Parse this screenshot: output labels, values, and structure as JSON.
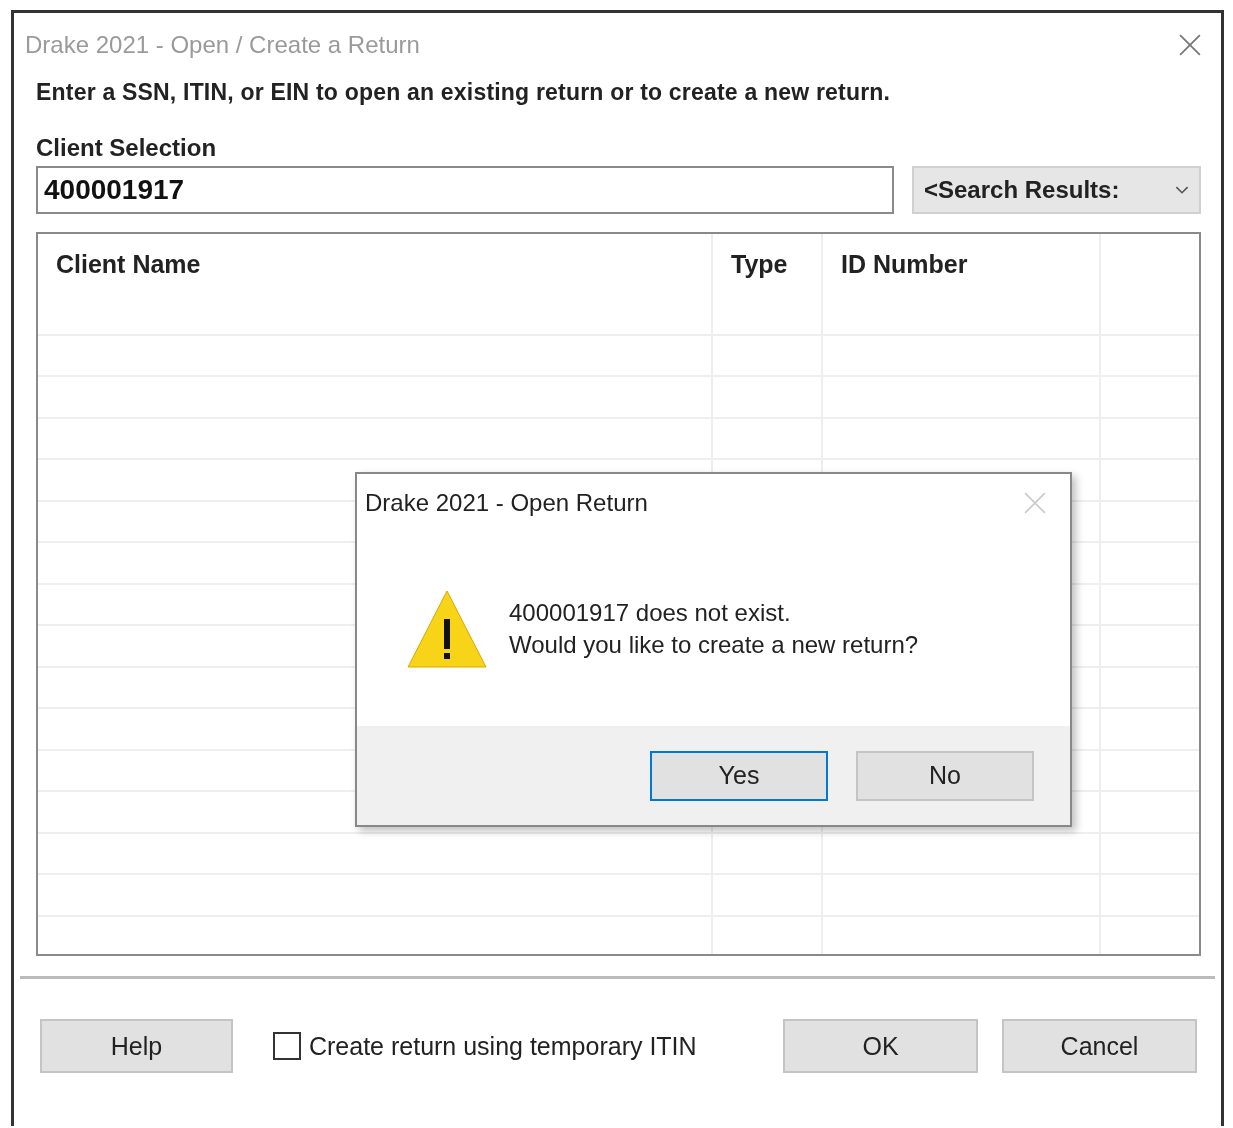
{
  "window": {
    "title": "Drake 2021 - Open / Create a Return"
  },
  "instruction": "Enter a SSN, ITIN, or EIN to open an existing return or to create a new return.",
  "client_selection": {
    "label": "Client Selection",
    "value": "400001917"
  },
  "search_dropdown": {
    "value": "<Search Results:"
  },
  "table": {
    "columns": [
      "Client Name",
      "Type",
      "ID Number"
    ]
  },
  "footer": {
    "help_button": "Help",
    "temp_itin": {
      "label": "Create return using temporary ITIN",
      "checked": false
    },
    "buttons": [
      {
        "label": "OK"
      },
      {
        "label": "Cancel"
      }
    ]
  },
  "dialog": {
    "title": "Drake 2021 - Open Return",
    "message_lines": [
      "400001917 does not exist.",
      "Would you like to create a new return?"
    ],
    "buttons": [
      {
        "label": "Yes",
        "selected": true
      },
      {
        "label": "No",
        "selected": false
      }
    ]
  }
}
